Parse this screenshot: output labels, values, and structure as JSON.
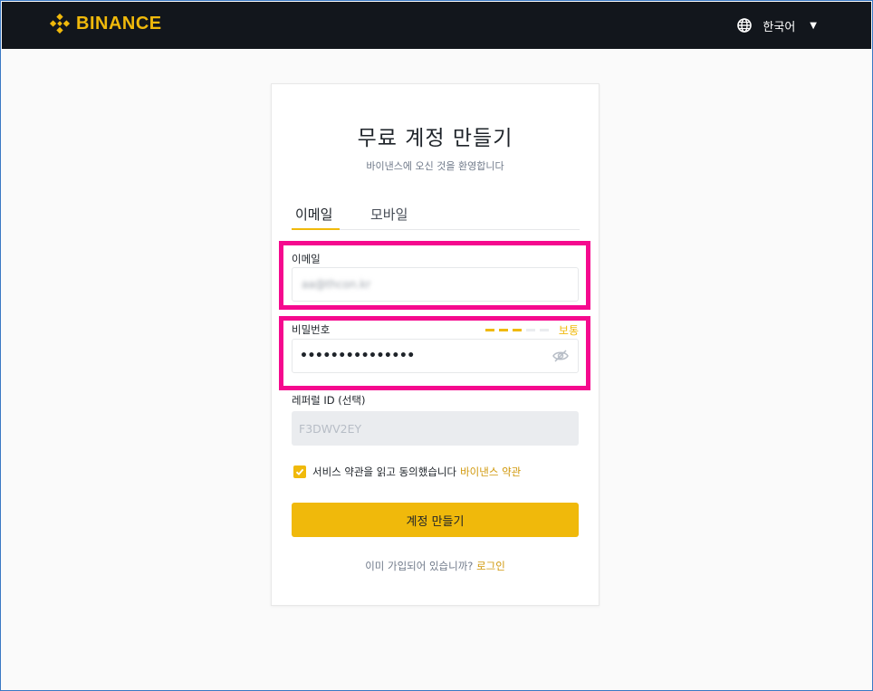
{
  "header": {
    "brand": "BINANCE",
    "language": "한국어",
    "brand_color": "#f0b90b"
  },
  "signup": {
    "title": "무료 계정 만들기",
    "subtitle": "바이낸스에 오신 것을 환영합니다",
    "tabs": [
      {
        "label": "이메일",
        "active": true
      },
      {
        "label": "모바일",
        "active": false
      }
    ],
    "email": {
      "label": "이메일",
      "value": "aa@thcon.kr"
    },
    "password": {
      "label": "비밀번호",
      "value": "•••••••••••••••",
      "strength_label": "보통",
      "strength_level": 0.5
    },
    "referral": {
      "label": "레퍼럴 ID (선택)",
      "value": "F3DWV2EY"
    },
    "terms": {
      "checked": true,
      "text": "서비스 약관을 읽고 동의했습니다",
      "link": "바이낸스 약관"
    },
    "submit_label": "계정 만들기",
    "login_prompt": "이미 가입되어 있습니까?",
    "login_link": "로그인"
  },
  "highlight_color": "#f5098e",
  "icons": [
    "binance-logo-icon",
    "globe-icon",
    "caret-down-icon",
    "eye-off-icon",
    "checkmark-icon"
  ]
}
